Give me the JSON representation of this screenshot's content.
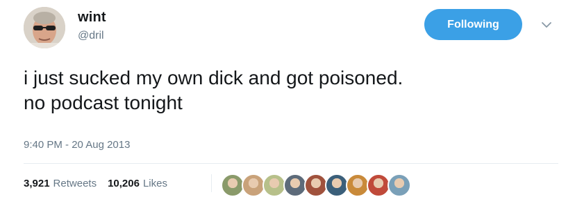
{
  "user": {
    "display_name": "wint",
    "screen_name": "@dril",
    "follow_label": "Following"
  },
  "tweet": {
    "text": "i just sucked my own dick and got poisoned.\nno podcast tonight",
    "timestamp": "9:40 PM - 20 Aug 2013"
  },
  "stats": {
    "retweets_count": "3,921",
    "retweets_label": "Retweets",
    "likes_count": "10,206",
    "likes_label": "Likes"
  },
  "likers": [
    {
      "name": "liker-avatar-1",
      "color": "#8a9a6a"
    },
    {
      "name": "liker-avatar-2",
      "color": "#c9a27a"
    },
    {
      "name": "liker-avatar-3",
      "color": "#b7c08a"
    },
    {
      "name": "liker-avatar-4",
      "color": "#5d6b7a"
    },
    {
      "name": "liker-avatar-5",
      "color": "#a0523d"
    },
    {
      "name": "liker-avatar-6",
      "color": "#3b5f7a"
    },
    {
      "name": "liker-avatar-7",
      "color": "#c98a3a"
    },
    {
      "name": "liker-avatar-8",
      "color": "#c04a3a"
    },
    {
      "name": "liker-avatar-9",
      "color": "#7aa0b8"
    }
  ],
  "colors": {
    "accent": "#3ba0e6",
    "secondary_text": "#657786",
    "primary_text": "#14171a"
  },
  "icons": {
    "caret": "chevron-down-icon"
  }
}
